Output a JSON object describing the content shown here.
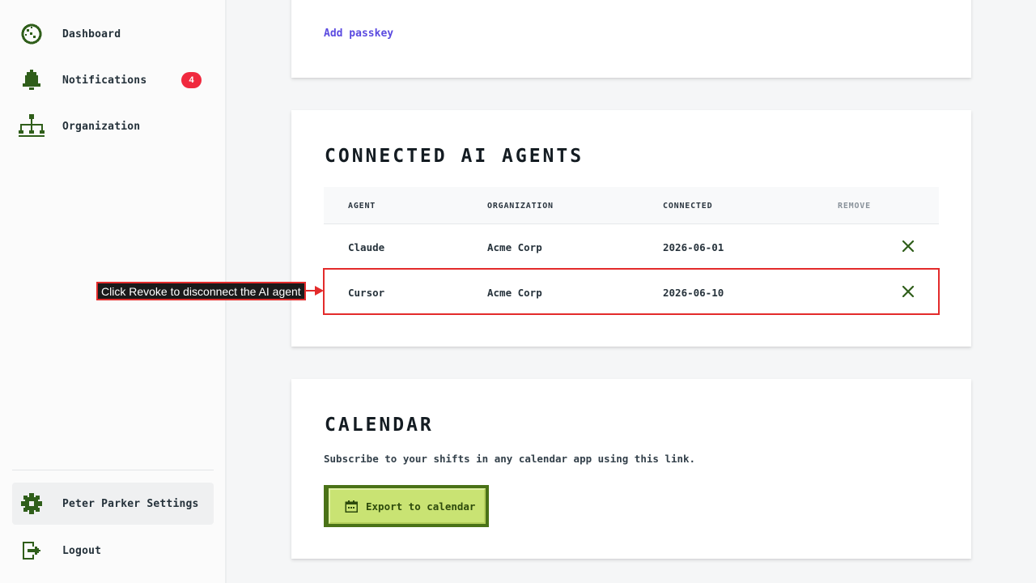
{
  "sidebar": {
    "items": [
      {
        "label": "Dashboard",
        "icon": "dashboard-icon"
      },
      {
        "label": "Notifications",
        "icon": "bell-icon",
        "badge": "4"
      },
      {
        "label": "Organization",
        "icon": "org-chart-icon"
      }
    ],
    "bottom": [
      {
        "label": "Peter Parker Settings",
        "icon": "gear-icon"
      },
      {
        "label": "Logout",
        "icon": "logout-icon"
      }
    ]
  },
  "passkey": {
    "add_label": "Add passkey"
  },
  "agents": {
    "title": "CONNECTED AI AGENTS",
    "headers": {
      "agent": "AGENT",
      "organization": "ORGANIZATION",
      "connected": "CONNECTED",
      "remove": "REMOVE"
    },
    "rows": [
      {
        "agent": "Claude",
        "organization": "Acme Corp",
        "connected": "2026-06-01"
      },
      {
        "agent": "Cursor",
        "organization": "Acme Corp",
        "connected": "2026-06-10"
      }
    ]
  },
  "calendar": {
    "title": "CALENDAR",
    "description": "Subscribe to your shifts in any calendar app using this link.",
    "export_label": "Export to calendar"
  },
  "annotation": {
    "text": "Click Revoke to disconnect the AI agent"
  },
  "colors": {
    "accent_green": "#2f5e1a",
    "badge_red": "#f0293e",
    "link_purple": "#5b4be0",
    "annotation_red": "#e32b2b",
    "button_lime": "#c9e373"
  }
}
